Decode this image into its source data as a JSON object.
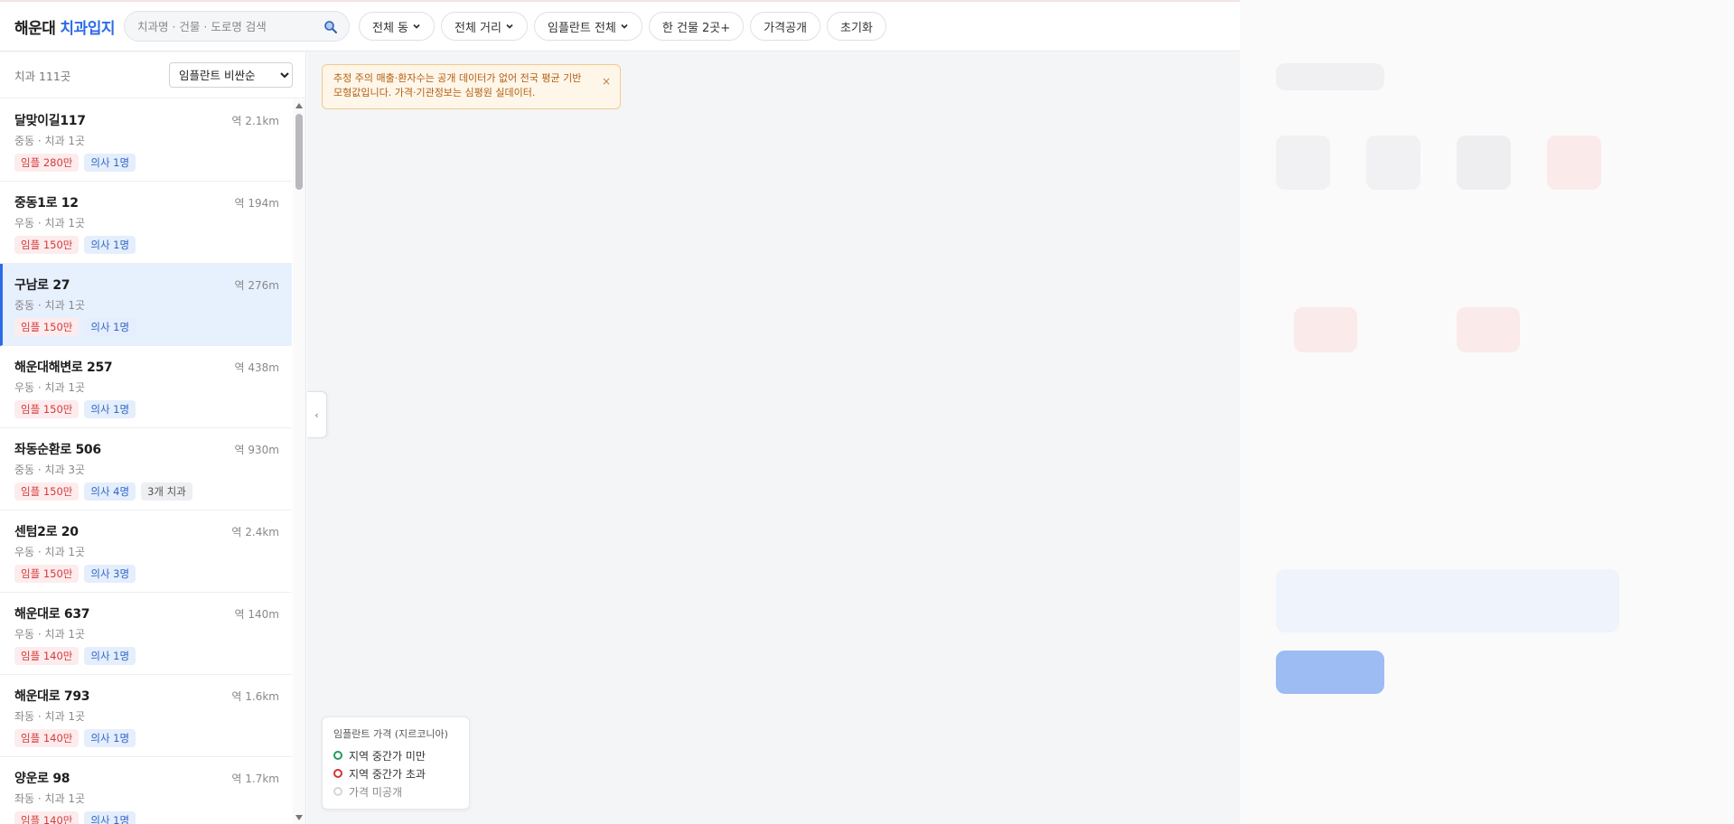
{
  "brand": {
    "part1": "해운대",
    "part2": "치과입지"
  },
  "search": {
    "placeholder": "치과명 · 건물 · 도로명 검색",
    "icon": "search-icon"
  },
  "filters": [
    {
      "label": "전체 동",
      "dropdown": true
    },
    {
      "label": "전체 거리",
      "dropdown": true
    },
    {
      "label": "임플란트 전체",
      "dropdown": true
    },
    {
      "label": "한 건물 2곳+",
      "dropdown": false
    },
    {
      "label": "가격공개",
      "dropdown": false
    },
    {
      "label": "초기화",
      "dropdown": false
    }
  ],
  "sidebar": {
    "count": "치과 111곳",
    "sort": {
      "selected": "임플란트 비싼순",
      "options": [
        "임플란트 비싼순"
      ]
    },
    "items": [
      {
        "name": "달맞이길117",
        "dist": "역 2.1km",
        "sub": "중동 · 치과 1곳",
        "tags": [
          {
            "text": "임플 280만",
            "kind": "red"
          },
          {
            "text": "의사 1명",
            "kind": "blue"
          }
        ],
        "selected": false
      },
      {
        "name": "중동1로 12",
        "dist": "역 194m",
        "sub": "우동 · 치과 1곳",
        "tags": [
          {
            "text": "임플 150만",
            "kind": "red"
          },
          {
            "text": "의사 1명",
            "kind": "blue"
          }
        ],
        "selected": false
      },
      {
        "name": "구남로 27",
        "dist": "역 276m",
        "sub": "중동 · 치과 1곳",
        "tags": [
          {
            "text": "임플 150만",
            "kind": "red"
          },
          {
            "text": "의사 1명",
            "kind": "blue"
          }
        ],
        "selected": true
      },
      {
        "name": "해운대해변로 257",
        "dist": "역 438m",
        "sub": "우동 · 치과 1곳",
        "tags": [
          {
            "text": "임플 150만",
            "kind": "red"
          },
          {
            "text": "의사 1명",
            "kind": "blue"
          }
        ],
        "selected": false
      },
      {
        "name": "좌동순환로 506",
        "dist": "역 930m",
        "sub": "중동 · 치과 3곳",
        "tags": [
          {
            "text": "임플 150만",
            "kind": "red"
          },
          {
            "text": "의사 4명",
            "kind": "blue"
          },
          {
            "text": "3개 치과",
            "kind": "gray"
          }
        ],
        "selected": false
      },
      {
        "name": "센텀2로 20",
        "dist": "역 2.4km",
        "sub": "우동 · 치과 1곳",
        "tags": [
          {
            "text": "임플 150만",
            "kind": "red"
          },
          {
            "text": "의사 3명",
            "kind": "blue"
          }
        ],
        "selected": false
      },
      {
        "name": "해운대로 637",
        "dist": "역 140m",
        "sub": "우동 · 치과 1곳",
        "tags": [
          {
            "text": "임플 140만",
            "kind": "red"
          },
          {
            "text": "의사 1명",
            "kind": "blue"
          }
        ],
        "selected": false
      },
      {
        "name": "해운대로 793",
        "dist": "역 1.6km",
        "sub": "좌동 · 치과 1곳",
        "tags": [
          {
            "text": "임플 140만",
            "kind": "red"
          },
          {
            "text": "의사 1명",
            "kind": "blue"
          }
        ],
        "selected": false
      },
      {
        "name": "양운로 98",
        "dist": "역 1.7km",
        "sub": "좌동 · 치과 1곳",
        "tags": [
          {
            "text": "임플 140만",
            "kind": "red"
          },
          {
            "text": "의사 1명",
            "kind": "blue"
          }
        ],
        "selected": false
      }
    ]
  },
  "notice": {
    "text": "추정 주의 매출·환자수는 공개 데이터가 없어 전국 평균 기반 모형값입니다. 가격·기관정보는 심평원 실데이터.",
    "close": "×"
  },
  "collapse": "‹",
  "legend": {
    "title": "임플란트 가격 (지르코니아)",
    "rows": [
      {
        "label": "지역 중간가 미만",
        "color": "#1f9d57"
      },
      {
        "label": "지역 중간가 초과",
        "color": "#d33333"
      },
      {
        "label": "가격 미공개",
        "color": "#d4d5d8"
      }
    ]
  },
  "colors": {
    "accent": "#2b6be6",
    "price_tag": "#d33a3a",
    "doctor_tag": "#3165c4"
  }
}
